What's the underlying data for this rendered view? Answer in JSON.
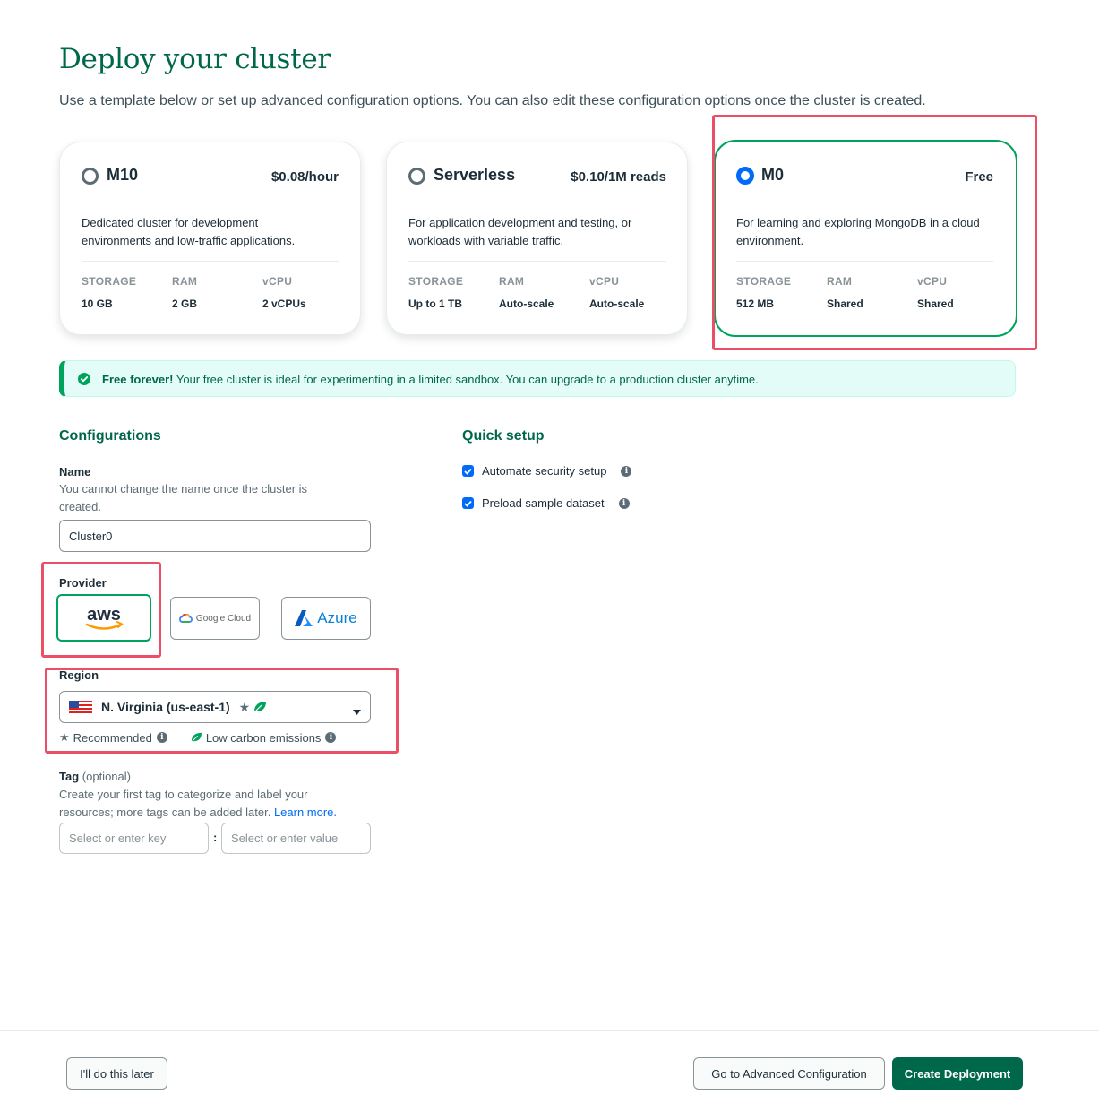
{
  "page": {
    "title": "Deploy your cluster",
    "subtitle": "Use a template below or set up advanced configuration options. You can also edit these configuration options once the cluster is created."
  },
  "tiers": [
    {
      "name": "M10",
      "price": "$0.08/hour",
      "selected": false,
      "desc_line1": "Dedicated cluster for development",
      "desc_line2": "environments and low-traffic applications.",
      "storage_label": "STORAGE",
      "storage": "10 GB",
      "ram_label": "RAM",
      "ram": "2 GB",
      "vcpu_label": "vCPU",
      "vcpu": "2 vCPUs"
    },
    {
      "name": "Serverless",
      "price": "$0.10/1M reads",
      "selected": false,
      "desc_line1": "For application development and testing, or",
      "desc_line2": "workloads with variable traffic.",
      "storage_label": "STORAGE",
      "storage": "Up to 1 TB",
      "ram_label": "RAM",
      "ram": "Auto-scale",
      "vcpu_label": "vCPU",
      "vcpu": "Auto-scale"
    },
    {
      "name": "M0",
      "price": "Free",
      "selected": true,
      "desc_line1": "For learning and exploring MongoDB in a cloud",
      "desc_line2": "environment.",
      "storage_label": "STORAGE",
      "storage": "512 MB",
      "ram_label": "RAM",
      "ram": "Shared",
      "vcpu_label": "vCPU",
      "vcpu": "Shared"
    }
  ],
  "banner": {
    "bold": "Free forever!",
    "text": " Your free cluster is ideal for experimenting in a limited sandbox. You can upgrade to a production cluster anytime."
  },
  "config": {
    "heading": "Configurations",
    "name_label": "Name",
    "name_desc_line1": "You cannot change the name once the cluster is",
    "name_desc_line2": "created.",
    "name_value": "Cluster0",
    "provider_label": "Provider",
    "providers": [
      "aws",
      "Google Cloud",
      "Azure"
    ],
    "selected_provider": "aws",
    "region_label": "Region",
    "region_value": "N. Virginia (us-east-1)",
    "recommended_label": "Recommended",
    "low_carbon_label": "Low carbon emissions",
    "tag_label": "Tag",
    "tag_optional": "(optional)",
    "tag_desc_line1": "Create your first tag to categorize and label your",
    "tag_desc_line2": "resources; more tags can be added later.",
    "tag_learn_more": "Learn more.",
    "tag_key_placeholder": "Select or enter key",
    "tag_separator": ":",
    "tag_value_placeholder": "Select or enter value"
  },
  "quick_setup": {
    "heading": "Quick setup",
    "options": [
      {
        "label": "Automate security setup",
        "checked": true
      },
      {
        "label": "Preload sample dataset",
        "checked": true
      }
    ]
  },
  "footer": {
    "later_button": "I'll do this later",
    "advanced_button": "Go to Advanced Configuration",
    "create_button": "Create Deployment"
  },
  "colors": {
    "brand_green": "#00684a",
    "accent_green": "#00a35c",
    "radio_blue": "#016bf8",
    "highlight_red": "#ea4f65"
  }
}
